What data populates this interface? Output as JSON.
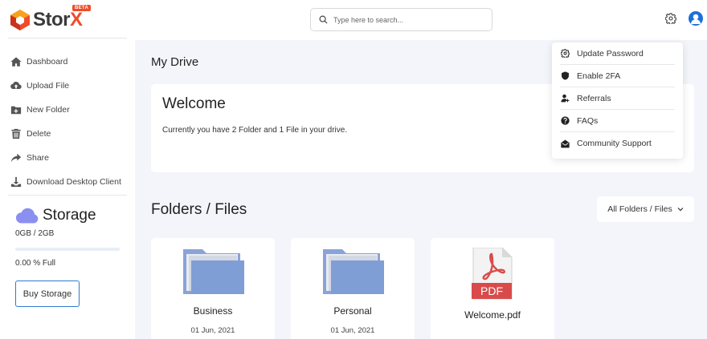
{
  "logo": {
    "text_main": "Stor",
    "text_accent": "X",
    "badge": "BETA"
  },
  "sidebar": {
    "items": [
      {
        "label": "Dashboard",
        "icon": "home-icon"
      },
      {
        "label": "Upload File",
        "icon": "cloud-upload-icon"
      },
      {
        "label": "New Folder",
        "icon": "folder-plus-icon"
      },
      {
        "label": "Delete",
        "icon": "trash-icon"
      },
      {
        "label": "Share",
        "icon": "share-icon"
      },
      {
        "label": "Download Desktop Client",
        "icon": "download-icon"
      }
    ],
    "storage": {
      "title": "Storage",
      "used": "0GB / 2GB",
      "percent_label": "0.00 % Full",
      "fill_fraction": 0.0,
      "buy_label": "Buy Storage"
    }
  },
  "header": {
    "search_placeholder": "Type here to search..."
  },
  "main": {
    "title": "My Drive",
    "welcome": {
      "title": "Welcome",
      "text": "Currently you have 2 Folder and 1 File in your drive."
    },
    "files_section": {
      "title": "Folders / Files",
      "filter_label": "All Folders / Files"
    },
    "items": [
      {
        "type": "folder",
        "name": "Business",
        "date": "01 Jun, 2021"
      },
      {
        "type": "folder",
        "name": "Personal",
        "date": "01 Jun, 2021"
      },
      {
        "type": "pdf",
        "name": "Welcome.pdf",
        "thumb_label": "PDF"
      }
    ]
  },
  "settings_menu": {
    "items": [
      {
        "label": "Update Password",
        "icon": "gear-icon"
      },
      {
        "label": "Enable 2FA",
        "icon": "shield-icon"
      },
      {
        "label": "Referrals",
        "icon": "user-plus-icon"
      },
      {
        "label": "FAQs",
        "icon": "question-icon"
      },
      {
        "label": "Community Support",
        "icon": "envelope-open-icon"
      }
    ]
  },
  "colors": {
    "accent": "#ef4c2a",
    "primary": "#2f7bd4",
    "folder": "#7f9ed6",
    "pdf": "#d94b4b"
  }
}
